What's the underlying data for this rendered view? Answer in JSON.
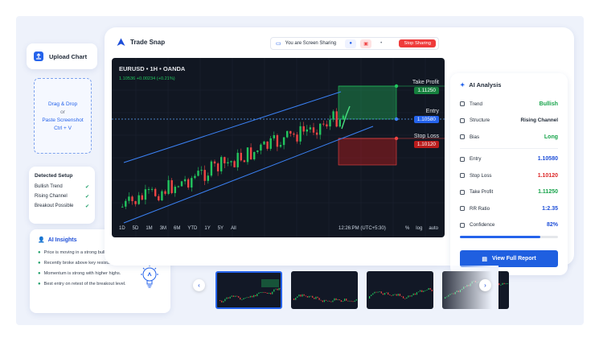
{
  "app": {
    "title": "Trade Snap"
  },
  "upload": {
    "label": "Upload Chart"
  },
  "drop": {
    "line1": "Drag & Drop",
    "line2": "or",
    "line3": "Paste Screenshot",
    "line4": "Ctrl + V"
  },
  "setup": {
    "title": "Detected Setup",
    "items": [
      "Bullish Trend",
      "Rising Channel",
      "Breakout Possible"
    ]
  },
  "insights": {
    "title": "AI Insights",
    "items": [
      "Price is moving in a strong bullish channel.",
      "Recently broke above key resistance zone.",
      "Momentum is strong with higher highs.",
      "Best entry on retest of the breakout level."
    ]
  },
  "share": {
    "status": "You are Screen Sharing",
    "stop_label": "Stop Sharing"
  },
  "chart": {
    "symbol": "EURUSD • 1H • OANDA",
    "quote": "1.10536 +0.00234 (+0.21%)",
    "timeframes": [
      "1D",
      "5D",
      "1M",
      "3M",
      "6M",
      "YTD",
      "1Y",
      "5Y",
      "All"
    ],
    "timestamp": "12:26:PM (UTC+5:30)",
    "scale_options": [
      "%",
      "log",
      "auto"
    ],
    "take_profit": {
      "label": "Take Profit",
      "value": "1.11250"
    },
    "entry": {
      "label": "Entry",
      "value": "1.10580"
    },
    "stop_loss": {
      "label": "Stop Loss",
      "value": "1.10120"
    }
  },
  "analysis": {
    "title": "AI Analysis",
    "rows": [
      {
        "label": "Trend",
        "value": "Bullish"
      },
      {
        "label": "Structure",
        "value": "Rising Channel"
      },
      {
        "label": "Bias",
        "value": "Long"
      }
    ],
    "levels": [
      {
        "label": "Entry",
        "value": "1.10580"
      },
      {
        "label": "Stop Loss",
        "value": "1.10120"
      },
      {
        "label": "Take Profit",
        "value": "1.11250"
      },
      {
        "label": "RR Ratio",
        "value": "1:2.35"
      },
      {
        "label": "Confidence",
        "value": "82%"
      }
    ],
    "confidence_fraction": 0.82,
    "button_label": "View Full Report"
  },
  "colors": {
    "accent": "#2563eb",
    "bull": "#22c55e",
    "bear": "#ef4444",
    "chart_bg": "#111722"
  }
}
